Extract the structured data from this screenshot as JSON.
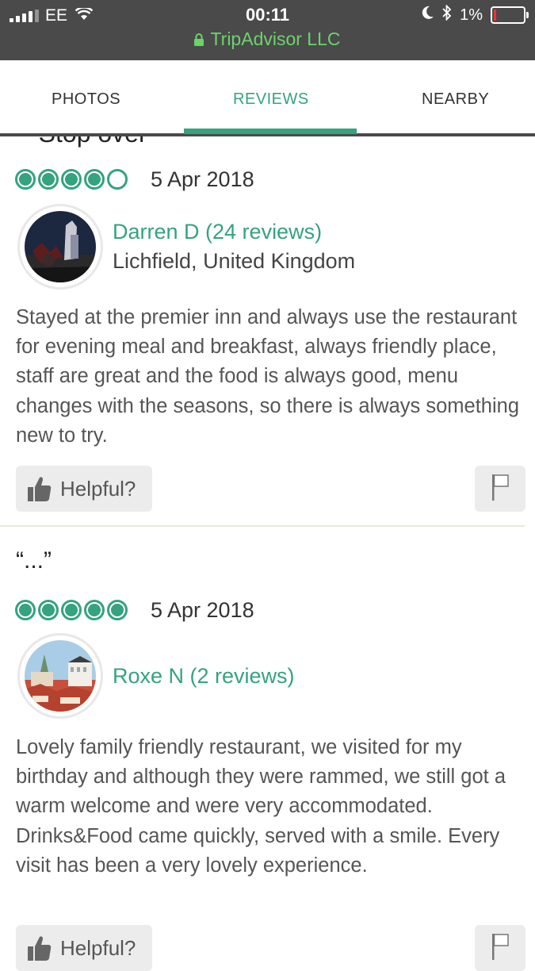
{
  "status_bar": {
    "carrier": "EE",
    "time": "00:11",
    "url": "TripAdvisor LLC",
    "battery": "1%",
    "battery_level": 0.01
  },
  "tabs": [
    {
      "label": "PHOTOS",
      "active": false
    },
    {
      "label": "REVIEWS",
      "active": true
    },
    {
      "label": "NEARBY",
      "active": false
    }
  ],
  "previous_review_title": "“Stop over”",
  "reviews": [
    {
      "rating": 4,
      "date": "5 Apr 2018",
      "reviewer": "Darren D (24 reviews)",
      "location": "Lichfield, United Kingdom",
      "text": "Stayed at the premier inn and always use the restaurant for evening meal and breakfast, always friendly place, staff are great and the food is always good, menu changes with the seasons, so there is always something new to try.",
      "helpful_label": "Helpful?"
    },
    {
      "title": "“...”",
      "rating": 5,
      "date": "5 Apr 2018",
      "reviewer": "Roxe N (2 reviews)",
      "text": "Lovely family friendly restaurant, we visited for my birthday and although they were rammed, we still got a warm welcome and were very accommodated. Drinks&Food came quickly, served with a smile. Every visit has been a very lovely experience.",
      "helpful_label": "Helpful?"
    }
  ],
  "colors": {
    "accent": "#34a37e",
    "status_bar": "#4a4a4a",
    "url_green": "#6cd36c"
  }
}
